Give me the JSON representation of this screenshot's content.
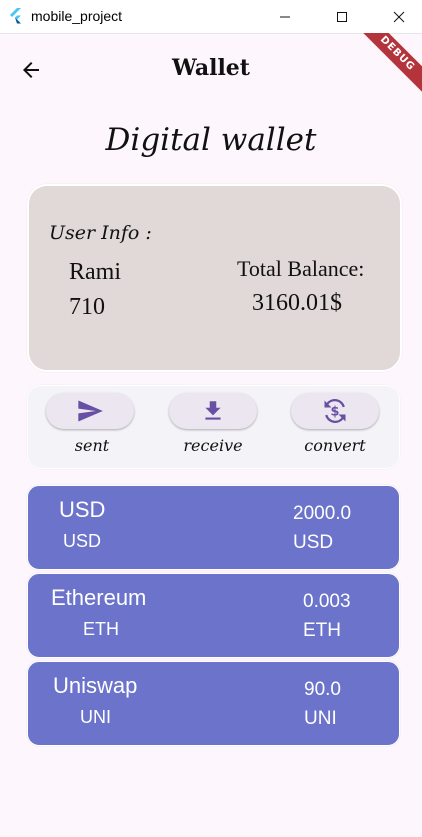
{
  "window": {
    "title": "mobile_project"
  },
  "debug_banner": "DEBUG",
  "appbar": {
    "title": "Wallet"
  },
  "heading": "Digital wallet",
  "user_card": {
    "label": "User Info :",
    "name": "Rami",
    "id": "710",
    "total_label": "Total Balance:",
    "total_value": "3160.01$"
  },
  "actions": [
    {
      "label": "sent",
      "icon": "send-icon"
    },
    {
      "label": "receive",
      "icon": "download-icon"
    },
    {
      "label": "convert",
      "icon": "currency-exchange-icon"
    }
  ],
  "currencies": [
    {
      "name": "USD",
      "code": "USD",
      "amount": "2000.0",
      "unit": "USD"
    },
    {
      "name": "Ethereum",
      "code": "ETH",
      "amount": "0.003",
      "unit": "ETH"
    },
    {
      "name": "Uniswap",
      "code": "UNI",
      "amount": "90.0",
      "unit": "UNI"
    }
  ],
  "colors": {
    "background": "#fdf7fd",
    "user_card": "#e1d8d8",
    "currency_card": "#6b73cb",
    "icon_accent": "#6750a4",
    "debug_ribbon": "#b3353b"
  }
}
